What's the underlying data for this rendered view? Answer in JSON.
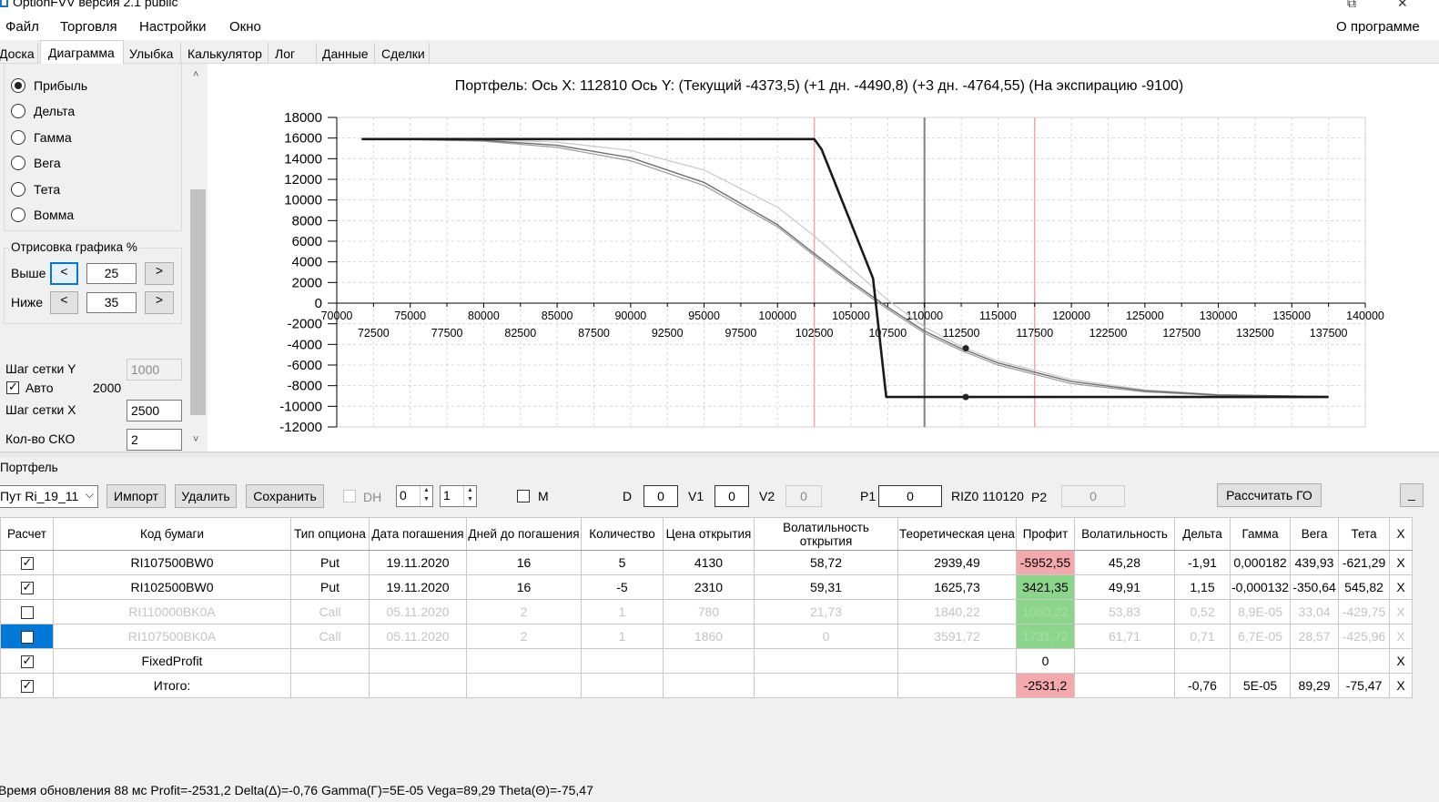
{
  "window": {
    "title": "OptionFVV версия 2.1 public",
    "controls": [
      "⧉",
      "✕"
    ]
  },
  "menu": {
    "items": [
      "Файл",
      "Торговля",
      "Настройки",
      "Окно"
    ],
    "about": "О программе"
  },
  "tabs": [
    {
      "label": "Доска"
    },
    {
      "label": "Диаграмма",
      "active": true
    },
    {
      "label": "Улыбка"
    },
    {
      "label": "Калькулятор"
    },
    {
      "label": "Лог"
    },
    {
      "label": "Данные"
    },
    {
      "label": "Сделки"
    }
  ],
  "left_panel": {
    "radios": [
      {
        "label": "Прибыль",
        "checked": true
      },
      {
        "label": "Дельта",
        "checked": false
      },
      {
        "label": "Гамма",
        "checked": false
      },
      {
        "label": "Вега",
        "checked": false
      },
      {
        "label": "Тета",
        "checked": false
      },
      {
        "label": "Вомма",
        "checked": false
      }
    ],
    "draw_group_label": "Отрисовка графика %",
    "above_label": "Выше",
    "above_value": "25",
    "below_label": "Ниже",
    "below_value": "35",
    "prev_btn": "<",
    "next_btn": ">",
    "grid_y_label": "Шаг сетки Y",
    "grid_y_value": "1000",
    "auto_label": "Авто",
    "auto_value": "2000",
    "grid_x_label": "Шаг сетки X",
    "grid_x_value": "2500",
    "sko_label": "Кол-во СКО",
    "sko_value": "2",
    "scroll_up": "˄",
    "scroll_down": "˅"
  },
  "chart_title": "Портфель: Ось X: 112810 Ось Y:  (Текущий -4373,5)  (+1 дн. -4490,8)  (+3 дн. -4764,55)  (На экспирацию -9100)",
  "chart_data": {
    "type": "line",
    "title": "Портфель: Ось X: 112810 Ось Y:  (Текущий -4373,5)  (+1 дн. -4490,8)  (+3 дн. -4764,55)  (На экспирацию -9100)",
    "xlim": [
      70000,
      140000
    ],
    "ylim": [
      -12000,
      18000
    ],
    "x_ticks_top": [
      "70000",
      "75000",
      "80000",
      "85000",
      "90000",
      "95000",
      "100000",
      "105000",
      "110000",
      "115000",
      "120000",
      "125000",
      "130000",
      "135000",
      "140000"
    ],
    "x_ticks_bottom": [
      "72500",
      "77500",
      "82500",
      "87500",
      "92500",
      "97500",
      "102500",
      "107500",
      "112500",
      "117500",
      "122500",
      "127500",
      "132500",
      "137500"
    ],
    "y_ticks": [
      "18000",
      "16000",
      "14000",
      "12000",
      "10000",
      "8000",
      "6000",
      "4000",
      "2000",
      "0",
      "-2000",
      "-4000",
      "-6000",
      "-8000",
      "-10000",
      "-12000"
    ],
    "grid": true,
    "vertical_markers": {
      "current": 110000,
      "lower_bound": 102500,
      "upper_bound": 117500
    },
    "series": [
      {
        "x": [
          71700,
          102500,
          103000,
          106500,
          107400,
          137500
        ],
        "y": [
          15900,
          15900,
          14900,
          2400,
          -9100,
          -9100
        ]
      },
      {
        "x": [
          71700,
          75000,
          80000,
          85000,
          90000,
          95000,
          100000,
          102500,
          105000,
          107500,
          110000,
          112500,
          115000,
          120000,
          125000,
          130000,
          137500
        ],
        "y": [
          15900,
          15880,
          15780,
          15300,
          14100,
          11700,
          7600,
          4800,
          2100,
          -400,
          -2700,
          -4400,
          -5800,
          -7600,
          -8500,
          -8900,
          -9050
        ]
      },
      {
        "x": [
          71700,
          75000,
          80000,
          85000,
          90000,
          95000,
          100000,
          102500,
          105000,
          107500,
          110000,
          112500,
          115000,
          120000,
          125000,
          130000,
          137500
        ],
        "y": [
          15900,
          15860,
          15700,
          15100,
          13800,
          11400,
          7400,
          4600,
          1900,
          -600,
          -2900,
          -4600,
          -6000,
          -7800,
          -8600,
          -8950,
          -9060
        ]
      },
      {
        "x": [
          71700,
          75000,
          80000,
          85000,
          90000,
          95000,
          100000,
          102500,
          105000,
          107500,
          110000,
          112500,
          115000,
          120000,
          125000,
          130000,
          137500
        ],
        "y": [
          15900,
          15900,
          15850,
          15600,
          14800,
          12900,
          9300,
          6500,
          3400,
          300,
          -2300,
          -4200,
          -5600,
          -7400,
          -8400,
          -8850,
          -9050
        ]
      }
    ],
    "points": [
      {
        "x": 112810,
        "y": -4373.5
      },
      {
        "x": 112810,
        "y": -9100
      }
    ]
  },
  "portfolio": {
    "section_label": "Портфель",
    "combo_value": "Пут Ri_19_11",
    "import_btn": "Импорт",
    "delete_btn": "Удалить",
    "save_btn": "Сохранить",
    "dh_label": "DH",
    "spin1": "0",
    "spin2": "1",
    "m_label": "M",
    "d_label": "D",
    "d_value": "0",
    "v1_label": "V1",
    "v1_value": "0",
    "v2_label": "V2",
    "v2_value": "0",
    "p1_label": "P1",
    "p1_value": "0",
    "riz_label": "RIZ0 110120",
    "p2_label": "P2",
    "p2_value": "0",
    "calc_go_btn": "Рассчитать ГО",
    "minimize_btn": "_"
  },
  "grid": {
    "columns": [
      "Расчет",
      "Код бумаги",
      "Тип опциона",
      "Дата погашения",
      "Дней до погашения",
      "Количество",
      "Цена открытия",
      "Волатильность открытия",
      "Теоретическая цена",
      "Профит",
      "Волатильность",
      "Дельта",
      "Гамма",
      "Вега",
      "Тета",
      "X"
    ],
    "rows": [
      {
        "checked": true,
        "cells": [
          "RI107500BW0",
          "Put",
          "19.11.2020",
          "16",
          "5",
          "4130",
          "58,72",
          "2939,49",
          "-5952,55",
          "45,28",
          "-1,91",
          "0,000182",
          "439,93",
          "-621,29",
          "X"
        ]
      },
      {
        "checked": true,
        "cells": [
          "RI102500BW0",
          "Put",
          "19.11.2020",
          "16",
          "-5",
          "2310",
          "59,31",
          "1625,73",
          "3421,35",
          "49,91",
          "1,15",
          "-0,000132",
          "-350,64",
          "545,82",
          "X"
        ]
      },
      {
        "checked": false,
        "cells": [
          "RI110000BK0A",
          "Call",
          "05.11.2020",
          "2",
          "1",
          "780",
          "21,73",
          "1840,22",
          "1060,22",
          "53,83",
          "0,52",
          "8,9E-05",
          "33,04",
          "-429,75",
          "X"
        ]
      },
      {
        "checked": false,
        "cells": [
          "RI107500BK0A",
          "Call",
          "05.11.2020",
          "2",
          "1",
          "1860",
          "0",
          "3591,72",
          "1731,72",
          "61,71",
          "0,71",
          "6,7E-05",
          "28,57",
          "-425,96",
          "X"
        ]
      },
      {
        "checked": true,
        "cells": [
          "FixedProfit",
          "",
          "",
          "",
          "",
          "",
          "",
          "",
          "0",
          "",
          "",
          "",
          "",
          "",
          "X"
        ]
      },
      {
        "checked": true,
        "cells": [
          "Итого:",
          "",
          "",
          "",
          "",
          "",
          "",
          "",
          "-2531,2",
          "",
          "-0,76",
          "5E-05",
          "89,29",
          "-75,47",
          "X"
        ]
      }
    ]
  },
  "status": {
    "text": "Время обновления 88 мс  Profit=-2531,2 Delta(Δ)=-0,76 Gamma(Γ)=5E-05 Vega=89,29 Theta(Θ)=-75,47"
  },
  "colors": {
    "accent": "#0078d7",
    "profit_negative": "#f4a9ad",
    "profit_positive": "#8bd68b",
    "expiry_line": "#1a1a1a",
    "current_line": "#808080",
    "bound_line": "#f3a6a6"
  }
}
